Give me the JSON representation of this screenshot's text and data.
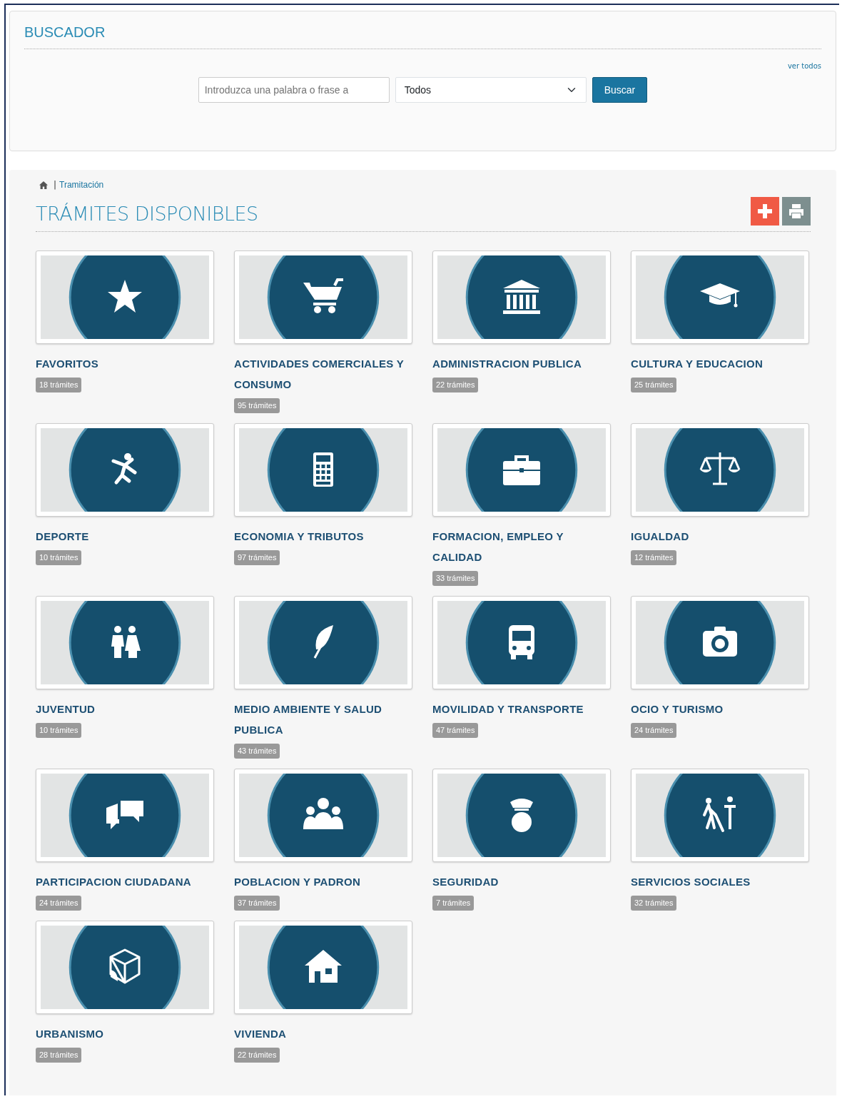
{
  "search": {
    "title": "BUSCADOR",
    "view_all": "ver todos",
    "placeholder": "Introduzca una palabra o frase a",
    "category": "Todos",
    "button": "Buscar"
  },
  "breadcrumb": {
    "separator": "|",
    "current": "Tramitación"
  },
  "page_title": "TRÁMITES DISPONIBLES",
  "categories": [
    {
      "name": "FAVORITOS",
      "count": "18 trámites"
    },
    {
      "name": "ACTIVIDADES COMERCIALES Y CONSUMO",
      "count": "95 trámites"
    },
    {
      "name": "ADMINISTRACION PUBLICA",
      "count": "22 trámites"
    },
    {
      "name": "CULTURA Y EDUCACION",
      "count": "25 trámites"
    },
    {
      "name": "DEPORTE",
      "count": "10 trámites"
    },
    {
      "name": "ECONOMIA Y TRIBUTOS",
      "count": "97 trámites"
    },
    {
      "name": "FORMACION, EMPLEO Y CALIDAD",
      "count": "33 trámites"
    },
    {
      "name": "IGUALDAD",
      "count": "12 trámites"
    },
    {
      "name": "JUVENTUD",
      "count": "10 trámites"
    },
    {
      "name": "MEDIO AMBIENTE Y SALUD PUBLICA",
      "count": "43 trámites"
    },
    {
      "name": "MOVILIDAD Y TRANSPORTE",
      "count": "47 trámites"
    },
    {
      "name": "OCIO Y TURISMO",
      "count": "24 trámites"
    },
    {
      "name": "PARTICIPACION CIUDADANA",
      "count": "24 trámites"
    },
    {
      "name": "POBLACION Y PADRON",
      "count": "37 trámites"
    },
    {
      "name": "SEGURIDAD",
      "count": "7 trámites"
    },
    {
      "name": "SERVICIOS SOCIALES",
      "count": "32 trámites"
    },
    {
      "name": "URBANISMO",
      "count": "28 trámites"
    },
    {
      "name": "VIVIENDA",
      "count": "22 trámites"
    }
  ]
}
